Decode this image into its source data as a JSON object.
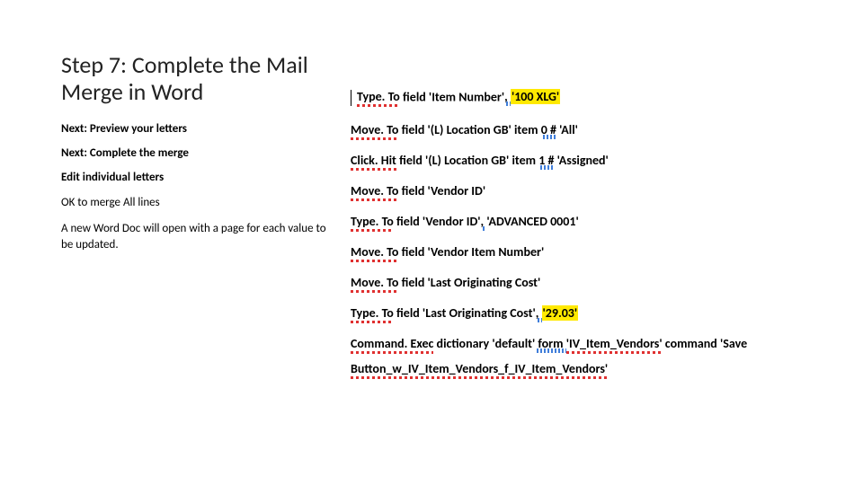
{
  "left": {
    "heading": "Step 7: Complete the Mail Merge in Word",
    "lines": [
      {
        "text": "Next: Preview your letters",
        "bold": true
      },
      {
        "text": "Next: Complete the merge",
        "bold": true
      },
      {
        "text": "Edit individual letters",
        "bold": true
      },
      {
        "text": "OK to merge All lines",
        "bold": false
      },
      {
        "text": "A new Word Doc will open with a page for each value to be updated.",
        "bold": false
      }
    ]
  },
  "right": {
    "rows": [
      {
        "cursor": true,
        "segments": [
          {
            "text": "Type. To",
            "style": "cmd-pre"
          },
          {
            "text": " field 'Item Number'",
            "style": "cmd-suffix"
          },
          {
            "text": ", ",
            "style": "grammar"
          },
          {
            "text": "'100 XLG'",
            "style": "hl"
          }
        ]
      },
      {
        "segments": [
          {
            "text": "Move. To",
            "style": "cmd-pre"
          },
          {
            "text": " field '(L) Location GB' item ",
            "style": "cmd-suffix"
          },
          {
            "text": "0 #",
            "style": "grammar"
          },
          {
            "text": " 'All'",
            "style": "cmd-suffix"
          }
        ]
      },
      {
        "segments": [
          {
            "text": "Click. Hit",
            "style": "cmd-pre"
          },
          {
            "text": " field '(L) Location GB' item ",
            "style": "cmd-suffix"
          },
          {
            "text": "1 #",
            "style": "grammar"
          },
          {
            "text": " 'Assigned'",
            "style": "cmd-suffix"
          }
        ]
      },
      {
        "segments": [
          {
            "text": "Move. To",
            "style": "cmd-pre"
          },
          {
            "text": " field 'Vendor ID'",
            "style": "cmd-suffix"
          }
        ]
      },
      {
        "segments": [
          {
            "text": "Type. To",
            "style": "cmd-pre"
          },
          {
            "text": " field 'Vendor ID'",
            "style": "cmd-suffix"
          },
          {
            "text": ", ",
            "style": "grammar"
          },
          {
            "text": "'ADVANCED 0001'",
            "style": "cmd-suffix"
          }
        ]
      },
      {
        "segments": [
          {
            "text": "Move. To",
            "style": "cmd-pre"
          },
          {
            "text": " field 'Vendor Item Number'",
            "style": "cmd-suffix"
          }
        ]
      },
      {
        "segments": [
          {
            "text": "Move. To",
            "style": "cmd-pre"
          },
          {
            "text": " field 'Last Originating Cost'",
            "style": "cmd-suffix"
          }
        ]
      },
      {
        "segments": [
          {
            "text": "Type. To",
            "style": "cmd-pre"
          },
          {
            "text": " field 'Last Originating Cost'",
            "style": "cmd-suffix"
          },
          {
            "text": ", ",
            "style": "grammar"
          },
          {
            "text": "'29.03'",
            "style": "hl"
          }
        ]
      },
      {
        "segments": [
          {
            "text": "Command. Exec",
            "style": "cmd-pre"
          },
          {
            "text": " dictionary 'default'",
            "style": "cmd-suffix"
          },
          {
            "text": " form ",
            "style": "grammar"
          },
          {
            "text": "'IV_Item_Vendors'",
            "style": "spell"
          },
          {
            "text": " command 'Save",
            "style": "cmd-suffix"
          }
        ]
      }
    ],
    "continuation": "Button_w_IV_Item_Vendors_f_IV_Item_Vendors'"
  }
}
